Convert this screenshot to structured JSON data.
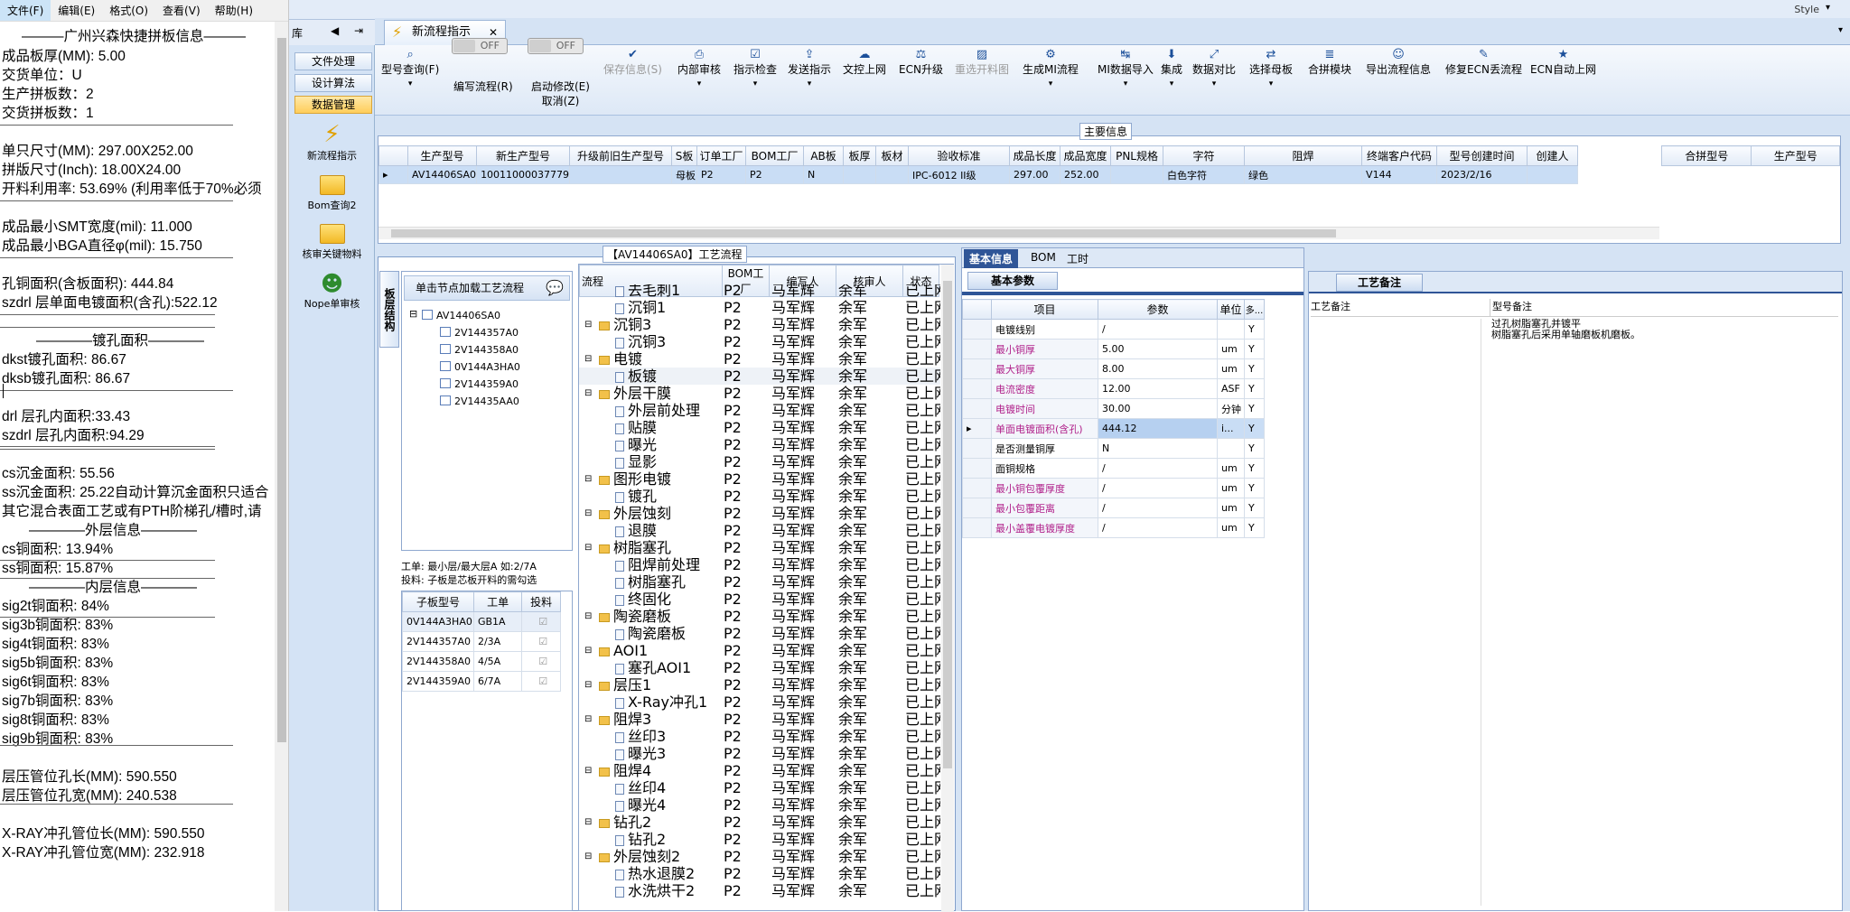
{
  "notepad": {
    "menu": [
      "文件(F)",
      "编辑(E)",
      "格式(O)",
      "查看(V)",
      "帮助(H)"
    ],
    "lines": [
      "———广州兴森快捷拼板信息———",
      "成品板厚(MM): 5.00",
      "交货单位：U",
      "生产拼板数：2",
      "交货拼板数：1",
      "单只尺寸(MM): 297.00X252.00",
      "拼版尺寸(Inch): 18.00X24.00",
      "开料利用率: 53.69% (利用率低于70%必须",
      "成品最小SMT宽度(mil): 11.000",
      "成品最小BGA直径φ(mil):  15.750",
      "孔铜面积(含板面积): 444.84",
      "szdrl          层单面电镀面积(含孔):522.12",
      "————镀孔面积————",
      "dkst镀孔面积: 86.67",
      "dksb镀孔面积: 86.67",
      "drl           层孔内面积:33.43",
      "szdrl         层孔内面积:94.29",
      "cs沉金面积: 55.56",
      "ss沉金面积: 25.22自动计算沉金面积只适合",
      "其它混合表面工艺或有PTH阶梯孔/槽时,请",
      "————外层信息————",
      "cs铜面积: 13.94%",
      "ss铜面积: 15.87%",
      "————内层信息————",
      "sig2t铜面积: 84%",
      "sig3b铜面积: 83%",
      "sig4t铜面积: 83%",
      "sig5b铜面积: 83%",
      "sig6t铜面积: 83%",
      "sig7b铜面积: 83%",
      "sig8t铜面积: 83%",
      "sig9b铜面积: 83%",
      "层压管位孔长(MM): 590.550",
      "层压管位孔宽(MM): 240.538",
      "X-RAY冲孔管位长(MM): 590.550",
      "X-RAY冲孔管位宽(MM): 232.918"
    ]
  },
  "window": {
    "style_label": "Style"
  },
  "sidebar": {
    "header": "库",
    "buttons": [
      "文件处理",
      "设计算法",
      "数据管理"
    ],
    "items": [
      "新流程指示",
      "Bom查询2",
      "核审关键物料",
      "Nope单审核"
    ]
  },
  "tab": {
    "label": "新流程指示"
  },
  "toolbar": {
    "buttons": [
      "型号查询(F)",
      "编写流程(R)",
      "启动修改(E)\n取消(Z)",
      "保存信息(S)",
      "内部审核",
      "指示检查",
      "发送指示",
      "文控上网",
      "ECN升级",
      "重选开料图",
      "生成MI流程",
      "MI数据导入",
      "集成",
      "数据对比",
      "选择母板",
      "合拼模块",
      "导出流程信息",
      "修复ECN丢流程",
      "ECN自动上网"
    ],
    "toggle_off": "OFF"
  },
  "main_info": {
    "title": "主要信息",
    "columns": [
      "生产型号",
      "新生产型号",
      "升级前旧生产型号",
      "S板",
      "订单工厂",
      "BOM工厂",
      "AB板",
      "板厚",
      "板材",
      "验收标准",
      "成品长度",
      "成品宽度",
      "PNL规格",
      "字符",
      "阻焊",
      "终端客户代码",
      "型号创建时间",
      "创建人"
    ],
    "row": [
      "AV14406SA0",
      "10011000037779",
      "",
      "母板",
      "P2",
      "P2",
      "N",
      "",
      "",
      "IPC-6012 II级",
      "297.00",
      "252.00",
      "",
      "白色字符",
      "绿色",
      "V144",
      "2023/2/16",
      ""
    ],
    "right_columns": [
      "合拼型号",
      "生产型号"
    ]
  },
  "process": {
    "title": "【AV14406SA0】工艺流程",
    "side_tab": "板层结构",
    "load_btn": "单击节点加载工艺流程",
    "tree_root": "AV14406SA0",
    "tree_children": [
      "2V144357A0",
      "2V144358A0",
      "0V144A3HA0",
      "2V144359A0",
      "2V14435AA0"
    ],
    "note1": "工单: 最小层/最大层A  如:2/7A",
    "note2": "投料: 子板是芯板开料的需勾选",
    "sub_columns": [
      "子板型号",
      "工单",
      "投料"
    ],
    "sub_rows": [
      [
        "0V144A3HA0",
        "GB1A"
      ],
      [
        "2V144357A0",
        "2/3A"
      ],
      [
        "2V144358A0",
        "4/5A"
      ],
      [
        "2V144359A0",
        "6/7A"
      ]
    ],
    "flow_columns": [
      "流程",
      "BOM工厂",
      "编写人",
      "核审人",
      "状态"
    ],
    "flow_rows": [
      {
        "n": "去毛刺1",
        "t": "c"
      },
      {
        "n": "沉铜1",
        "t": "c"
      },
      {
        "n": "沉铜3",
        "t": "g"
      },
      {
        "n": "沉铜3",
        "t": "c"
      },
      {
        "n": "电镀",
        "t": "g"
      },
      {
        "n": "板镀",
        "t": "c"
      },
      {
        "n": "外层干膜",
        "t": "g"
      },
      {
        "n": "外层前处理",
        "t": "c"
      },
      {
        "n": "贴膜",
        "t": "c"
      },
      {
        "n": "曝光",
        "t": "c"
      },
      {
        "n": "显影",
        "t": "c"
      },
      {
        "n": "图形电镀",
        "t": "g"
      },
      {
        "n": "镀孔",
        "t": "c"
      },
      {
        "n": "外层蚀刻",
        "t": "g"
      },
      {
        "n": "退膜",
        "t": "c"
      },
      {
        "n": "树脂塞孔",
        "t": "g"
      },
      {
        "n": "阻焊前处理",
        "t": "c"
      },
      {
        "n": "树脂塞孔",
        "t": "c"
      },
      {
        "n": "终固化",
        "t": "c"
      },
      {
        "n": "陶瓷磨板",
        "t": "g"
      },
      {
        "n": "陶瓷磨板",
        "t": "c"
      },
      {
        "n": "AOI1",
        "t": "g"
      },
      {
        "n": "塞孔AOI1",
        "t": "c"
      },
      {
        "n": "层压1",
        "t": "g"
      },
      {
        "n": "X-Ray冲孔1",
        "t": "c"
      },
      {
        "n": "阻焊3",
        "t": "g"
      },
      {
        "n": "丝印3",
        "t": "c"
      },
      {
        "n": "曝光3",
        "t": "c"
      },
      {
        "n": "阻焊4",
        "t": "g"
      },
      {
        "n": "丝印4",
        "t": "c"
      },
      {
        "n": "曝光4",
        "t": "c"
      },
      {
        "n": "钻孔2",
        "t": "g"
      },
      {
        "n": "钻孔2",
        "t": "c"
      },
      {
        "n": "外层蚀刻2",
        "t": "g"
      },
      {
        "n": "热水退膜2",
        "t": "c"
      },
      {
        "n": "水洗烘干2",
        "t": "c"
      }
    ],
    "flow_bom": "P2",
    "flow_writer": "马军辉",
    "flow_reviewer": "余军",
    "flow_status": "已上网"
  },
  "basic": {
    "tabs": [
      "基本信息",
      "BOM",
      "工时"
    ],
    "sub_tab": "基本参数",
    "columns": [
      "项目",
      "参数",
      "单位",
      "多..."
    ],
    "rows": [
      {
        "k": "电镀线别",
        "v": "/",
        "u": "",
        "y": "Y",
        "pink": false
      },
      {
        "k": "最小铜厚",
        "v": "5.00",
        "u": "um",
        "y": "Y",
        "pink": true
      },
      {
        "k": "最大铜厚",
        "v": "8.00",
        "u": "um",
        "y": "Y",
        "pink": true
      },
      {
        "k": "电流密度",
        "v": "12.00",
        "u": "ASF",
        "y": "Y",
        "pink": true
      },
      {
        "k": "电镀时间",
        "v": "30.00",
        "u": "分钟",
        "y": "Y",
        "pink": true
      },
      {
        "k": "单面电镀面积(含孔)",
        "v": "444.12",
        "u": "i...",
        "y": "Y",
        "pink": true
      },
      {
        "k": "是否测量铜厚",
        "v": "N",
        "u": "",
        "y": "Y",
        "pink": false
      },
      {
        "k": "面铜规格",
        "v": "/",
        "u": "um",
        "y": "Y",
        "pink": false
      },
      {
        "k": "最小铜包覆厚度",
        "v": "/",
        "u": "um",
        "y": "Y",
        "pink": true
      },
      {
        "k": "最小包覆距离",
        "v": "/",
        "u": "um",
        "y": "Y",
        "pink": true
      },
      {
        "k": "最小盖覆电镀厚度",
        "v": "/",
        "u": "um",
        "y": "Y",
        "pink": true
      }
    ]
  },
  "remark": {
    "tab": "工艺备注",
    "col1": "工艺备注",
    "col2": "型号备注",
    "text1": "过孔树脂塞孔并镀平",
    "text2": "树脂塞孔后采用单轴磨板机磨板。"
  }
}
